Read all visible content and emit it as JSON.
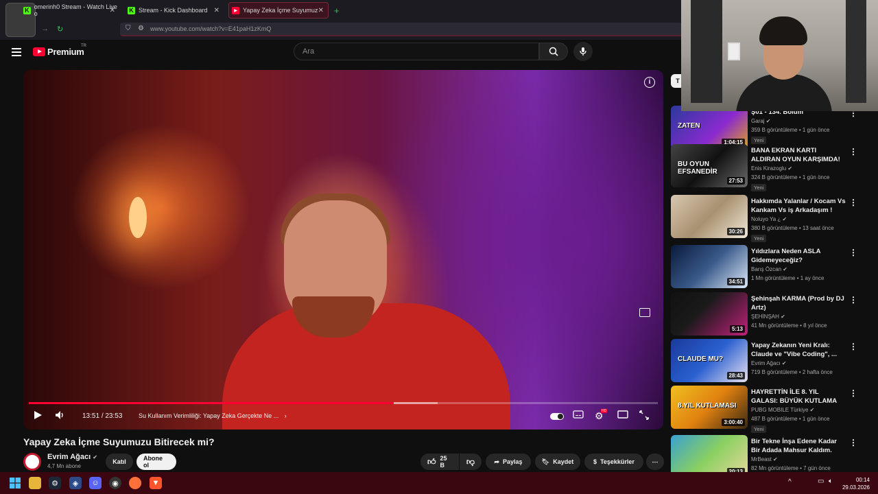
{
  "browser": {
    "tabs": [
      {
        "label": "omerinh0 Stream - Watch Live o",
        "favicon": "kick-logo"
      },
      {
        "label": "Stream - Kick Dashboard",
        "favicon": "kick-logo"
      },
      {
        "label": "Yapay Zeka İçme Suyumuzu Biti",
        "favicon": "youtube-logo"
      }
    ],
    "new_tab": "+",
    "url": "www.youtube.com/watch?v=E41paH1zKmQ"
  },
  "header": {
    "logo_text": "Premium",
    "region": "TR",
    "search_placeholder": "Ara"
  },
  "player": {
    "current_time": "13:51",
    "separator": "/",
    "duration": "23:53",
    "played_fraction": 0.58,
    "loaded_fraction": 0.65,
    "chapter": "Su Kullanım Verimliliği: Yapay Zeka Gerçekte Ne ...",
    "quality_badge": "HD"
  },
  "video": {
    "title": "Yapay Zeka İçme Suyumuzu Bitirecek mi?",
    "channel": "Evrim Ağacı",
    "subscribers": "4,7 Mn abone",
    "join_label": "Katıl",
    "subscribe_label": "Abone ol",
    "likes": "25 B",
    "share_label": "Paylaş",
    "save_label": "Kaydet",
    "thanks_label": "Teşekkürler"
  },
  "sidebar": {
    "chip": "T",
    "items": [
      {
        "title": "Ş01 - 134. Bölüm",
        "channel": "Garaj",
        "meta": "359 B görüntüleme • 1 gün önce",
        "badge": "Yeni",
        "duration": "1:04:15",
        "thumb_text": "ZATEN"
      },
      {
        "title": "BANA EKRAN KARTI ALDIRAN OYUN KARŞIMDA!",
        "channel": "Enis Kirazoglu",
        "meta": "324 B görüntüleme • 1 gün önce",
        "badge": "Yeni",
        "duration": "27:53",
        "thumb_text": "BU OYUN EFSANEDİR"
      },
      {
        "title": "Hakkımda Yalanlar / Kocam Vs Kankam Vs iş Arkadaşım !",
        "channel": "Noluyo Ya ¿",
        "meta": "380 B görüntüleme • 13 saat önce",
        "badge": "Yeni",
        "duration": "30:26",
        "thumb_text": ""
      },
      {
        "title": "Yıldızlara Neden ASLA Gidemeyeceğiz?",
        "channel": "Barış Özcan",
        "meta": "1 Mn görüntüleme • 1 ay önce",
        "badge": "",
        "duration": "34:51",
        "thumb_text": ""
      },
      {
        "title": "Şehinşah   KARMA (Prod by DJ Artz)",
        "channel": "ŞEHİNŞAH",
        "meta": "41 Mn görüntüleme • 8 yıl önce",
        "badge": "",
        "duration": "5:13",
        "thumb_text": ""
      },
      {
        "title": "Yapay Zekanın Yeni Kralı: Claude ve \"Vibe Coding\", ...",
        "channel": "Evrim Ağacı",
        "meta": "719 B görüntüleme • 2 hafta önce",
        "badge": "",
        "duration": "28:43",
        "thumb_text": "CLAUDE MU?"
      },
      {
        "title": "HAYRETTİN İLE 8. YIL GALASI: BÜYÜK KUTLAMA",
        "channel": "PUBG MOBILE Türkiye",
        "meta": "487 B görüntüleme • 1 gün önce",
        "badge": "Yeni",
        "duration": "3:00:40",
        "thumb_text": "8.YIL KUTLAMASI"
      },
      {
        "title": "Bir Tekne İnşa Edene Kadar Bir Adada Mahsur Kaldım.",
        "channel": "MrBeast",
        "meta": "82 Mn görüntüleme • 7 gün önce",
        "badge": "",
        "duration": "20:13",
        "thumb_text": ""
      }
    ]
  },
  "taskbar": {
    "time": "00:14",
    "date": "29.03.2026"
  },
  "colors": {
    "accent": "#ff0033",
    "taskbar": "#3a0710",
    "background": "#0f0f0f"
  }
}
